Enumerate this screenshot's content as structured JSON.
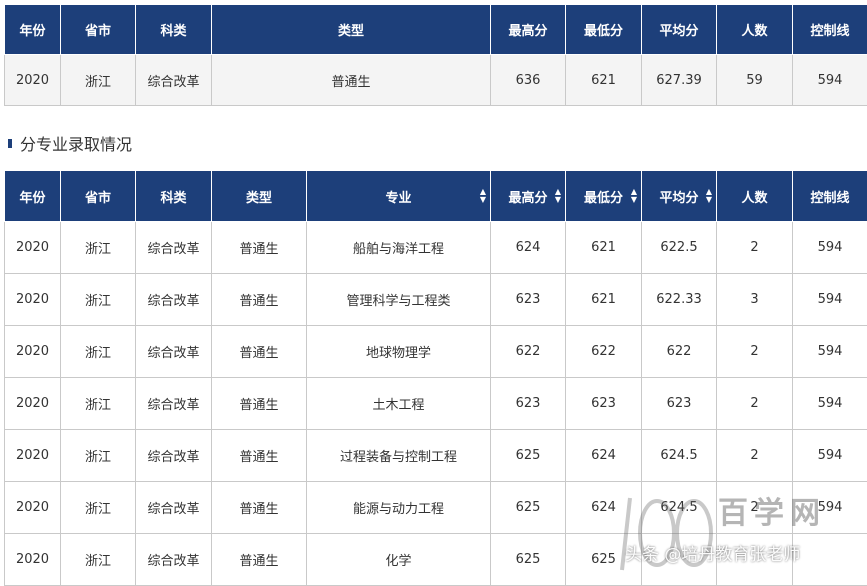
{
  "summary": {
    "headers": [
      "年份",
      "省市",
      "科类",
      "类型",
      "最高分",
      "最低分",
      "平均分",
      "人数",
      "控制线"
    ],
    "row": [
      "2020",
      "浙江",
      "综合改革",
      "普通生",
      "636",
      "621",
      "627.39",
      "59",
      "594"
    ]
  },
  "section_title": "分专业录取情况",
  "majors": {
    "headers": [
      "年份",
      "省市",
      "科类",
      "类型",
      "专业",
      "最高分",
      "最低分",
      "平均分",
      "人数",
      "控制线"
    ],
    "sortable_cols": [
      4,
      5,
      6,
      7
    ],
    "rows": [
      [
        "2020",
        "浙江",
        "综合改革",
        "普通生",
        "船舶与海洋工程",
        "624",
        "621",
        "622.5",
        "2",
        "594"
      ],
      [
        "2020",
        "浙江",
        "综合改革",
        "普通生",
        "管理科学与工程类",
        "623",
        "621",
        "622.33",
        "3",
        "594"
      ],
      [
        "2020",
        "浙江",
        "综合改革",
        "普通生",
        "地球物理学",
        "622",
        "622",
        "622",
        "2",
        "594"
      ],
      [
        "2020",
        "浙江",
        "综合改革",
        "普通生",
        "土木工程",
        "623",
        "623",
        "623",
        "2",
        "594"
      ],
      [
        "2020",
        "浙江",
        "综合改革",
        "普通生",
        "过程装备与控制工程",
        "625",
        "624",
        "624.5",
        "2",
        "594"
      ],
      [
        "2020",
        "浙江",
        "综合改革",
        "普通生",
        "能源与动力工程",
        "625",
        "624",
        "624.5",
        "2",
        "594"
      ],
      [
        "2020",
        "浙江",
        "综合改革",
        "普通生",
        "化学",
        "625",
        "625",
        "",
        "",
        ""
      ]
    ]
  },
  "watermark": {
    "site": "百学网",
    "author": "头条 @培丹教育张老师"
  },
  "colors": {
    "header_bg": "#1d3f7a",
    "border": "#c9c9c9"
  }
}
